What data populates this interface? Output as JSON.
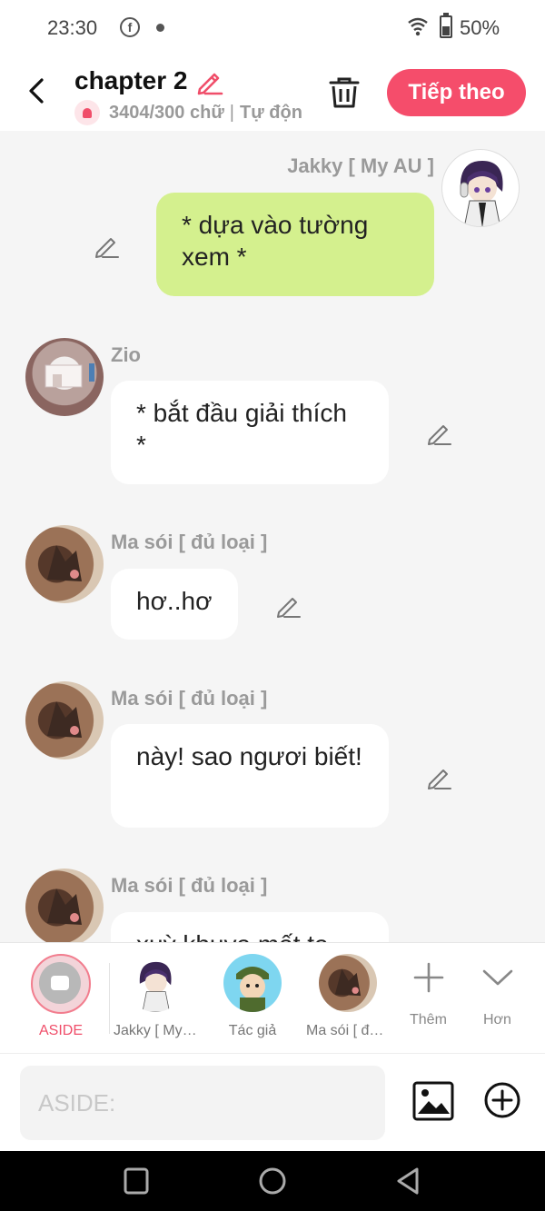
{
  "status": {
    "time": "23:30",
    "battery": "50%",
    "battery_level": 0.5
  },
  "header": {
    "title": "chapter 2",
    "word_count": "3404/300 chữ",
    "save_mode": "Tự động lưu",
    "next_label": "Tiếp theo"
  },
  "messages": [
    {
      "name": "Jakky [ My AU ]",
      "text": "* dựa vào tường xem *",
      "side": "right"
    },
    {
      "name": "Zio",
      "text": "* bắt đầu giải thích *",
      "side": "left"
    },
    {
      "name": "Ma sói [ đủ loại ]",
      "text": "hơ..hơ",
      "side": "left"
    },
    {
      "name": "Ma sói [ đủ loại ]",
      "text": "này! sao ngươi biết!",
      "side": "left"
    },
    {
      "name": "Ma sói [ đủ loại ]",
      "text": "xuỳ khuya mất ta",
      "side": "left"
    }
  ],
  "characters": [
    {
      "label": "ASIDE",
      "icon": "aside-icon",
      "active": true
    },
    {
      "label": "Jakky [ My AU ]",
      "icon": "avatar"
    },
    {
      "label": "Tác giả",
      "icon": "avatar"
    },
    {
      "label": "Ma sói [ đủ loại ]",
      "icon": "avatar"
    },
    {
      "label": "Thêm",
      "icon": "plus-icon"
    },
    {
      "label": "Hơn",
      "icon": "chevron-down-icon"
    }
  ],
  "input": {
    "placeholder": "ASIDE:"
  },
  "colors": {
    "accent": "#f54d6b",
    "bubble_mine": "#d4f08e",
    "bubble_other": "#ffffff",
    "background": "#f5f5f5"
  }
}
